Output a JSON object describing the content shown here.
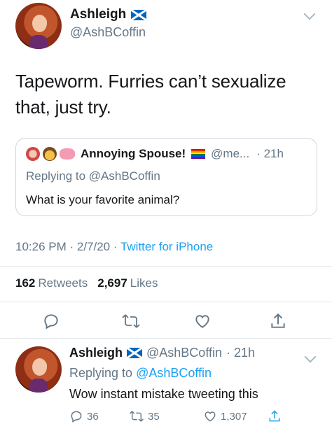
{
  "tweet": {
    "author_name": "Ashleigh",
    "author_handle": "@AshBCoffin",
    "text": "Tapeworm. Furries can’t sexualize that, just try.",
    "quoted": {
      "author_name": "Annoying Spouse!",
      "handle_truncated": "@me...",
      "time_ago": "· 21h",
      "replying_prefix": "Replying to",
      "replying_handle": "@AshBCoffin",
      "text": "What is your favorite animal?"
    },
    "timestamp": "10:26 PM · 2/7/20 ·",
    "source": "Twitter for iPhone",
    "retweet_count": "162",
    "retweet_label": "Retweets",
    "like_count": "2,697",
    "like_label": "Likes"
  },
  "reply": {
    "author_name": "Ashleigh",
    "author_handle": "@AshBCoffin",
    "time_ago": "· 21h",
    "replying_prefix": "Replying to",
    "replying_handle": "@AshBCoffin",
    "text": "Wow instant mistake tweeting this",
    "reply_count": "36",
    "retweet_count": "35",
    "like_count": "1,307"
  },
  "icons": {
    "reply": "reply-icon",
    "retweet": "retweet-icon",
    "like": "heart-icon",
    "share": "share-icon",
    "more": "chevron-down-icon",
    "flag": "scotland-flag-icon"
  },
  "colors": {
    "link": "#1da1f2",
    "muted": "#657786",
    "text": "#14171a",
    "border": "#e1e8ed"
  }
}
